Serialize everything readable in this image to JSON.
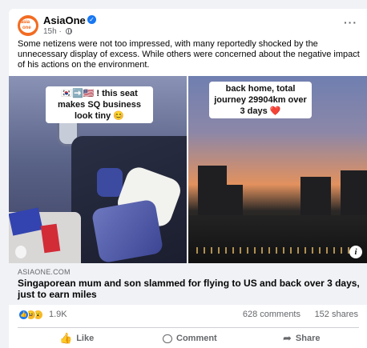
{
  "post": {
    "page_name": "AsiaOne",
    "avatar_text_top": "asia",
    "avatar_text_bottom": "one",
    "time": "15h",
    "caption": "Some netizens were not too impressed, with many reportedly shocked by the unnecessary display of excess. While others were concerned about the negative impact of his actions on the environment."
  },
  "media": {
    "left_overlay": "🇰🇷➡️🇺🇸 ! this seat makes SQ business look tiny 😊",
    "right_overlay": "back home, total journey 29904km over 3 days ❤️"
  },
  "link": {
    "domain": "ASIAONE.COM",
    "title": "Singaporean mum and son slammed for flying to US and back over 3 days, just to earn miles"
  },
  "stats": {
    "reaction_count": "1.9K",
    "comments": "628 comments",
    "shares": "152 shares"
  },
  "actions": {
    "like": "Like",
    "comment": "Comment",
    "share": "Share"
  },
  "colors": {
    "brand": "#f26c22",
    "verified": "#1877f2",
    "secondary_text": "#65676b"
  },
  "icons": [
    "verified-badge-icon",
    "globe-icon",
    "more-options-icon",
    "info-icon",
    "like-reaction-icon",
    "haha-reaction-icon",
    "wow-reaction-icon",
    "thumbs-up-icon",
    "comment-icon",
    "share-icon"
  ]
}
